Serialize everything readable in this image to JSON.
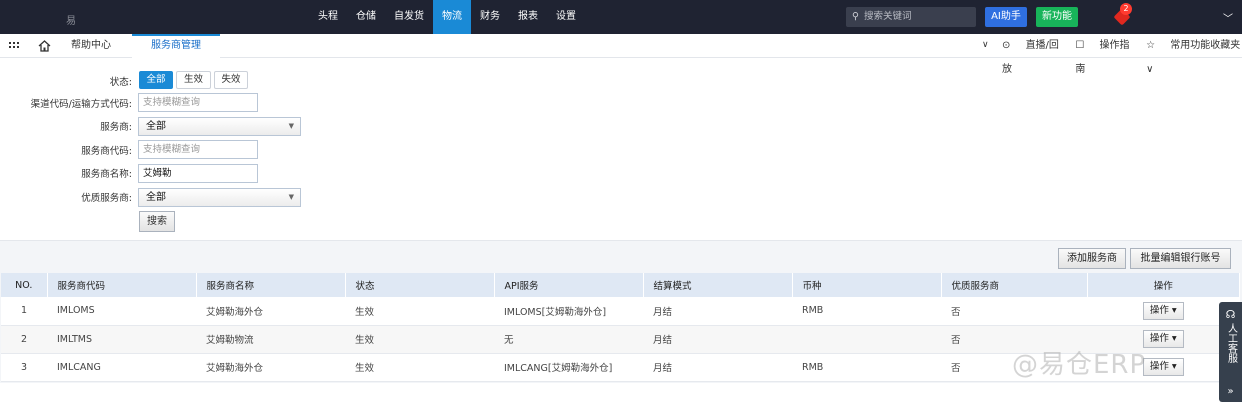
{
  "top_nav": {
    "logo_text": "易",
    "items": [
      {
        "label": "头程"
      },
      {
        "label": "仓储"
      },
      {
        "label": "自发货"
      },
      {
        "label": "物流",
        "active": true
      },
      {
        "label": "财务"
      },
      {
        "label": "报表"
      },
      {
        "label": "设置"
      }
    ],
    "search_placeholder": "搜索关键词",
    "ai_button": "AI助手",
    "new_button": "新功能",
    "notification_count": "2",
    "colors": {
      "bar": "#1f2332",
      "active": "#1a8ad6",
      "ai": "#2f6fe0",
      "new": "#18b45a",
      "badge": "#ff3b30"
    }
  },
  "sub_nav": {
    "tabs": [
      {
        "label": "帮助中心"
      },
      {
        "label": "服务商管理",
        "active": true
      }
    ],
    "right_links": [
      "直播/回放",
      "操作指南",
      "常用功能收藏夹"
    ]
  },
  "filters": {
    "status_label": "状态:",
    "status_options": [
      "全部",
      "生效",
      "失效"
    ],
    "channel_label": "渠道代码/运输方式代码:",
    "channel_placeholder": "支持模糊查询",
    "provider_label": "服务商:",
    "provider_value": "全部",
    "provider_code_label": "服务商代码:",
    "provider_code_placeholder": "支持模糊查询",
    "provider_name_label": "服务商名称:",
    "provider_name_value": "艾姆勒",
    "premium_label": "优质服务商:",
    "premium_value": "全部",
    "search_button": "搜索"
  },
  "actions": {
    "add_provider": "添加服务商",
    "batch_edit_bank": "批量编辑银行账号"
  },
  "table": {
    "headers": [
      "NO.",
      "服务商代码",
      "服务商名称",
      "状态",
      "API服务",
      "结算模式",
      "币种",
      "优质服务商",
      "操作"
    ],
    "rows": [
      {
        "no": "1",
        "code": "IMLOMS",
        "name": "艾姆勒海外仓",
        "status": "生效",
        "api": "IMLOMS[艾姆勒海外仓]",
        "settle": "月结",
        "currency": "RMB",
        "premium": "否",
        "op": "操作"
      },
      {
        "no": "2",
        "code": "IMLTMS",
        "name": "艾姆勒物流",
        "status": "生效",
        "api": "无",
        "settle": "月结",
        "currency": "",
        "premium": "否",
        "op": "操作"
      },
      {
        "no": "3",
        "code": "IMLCANG",
        "name": "艾姆勒海外仓",
        "status": "生效",
        "api": "IMLCANG[艾姆勒海外仓]",
        "settle": "月结",
        "currency": "RMB",
        "premium": "否",
        "op": "操作"
      }
    ]
  },
  "service_tab": {
    "label": "人工客服"
  },
  "watermark": "@易仓ERP"
}
